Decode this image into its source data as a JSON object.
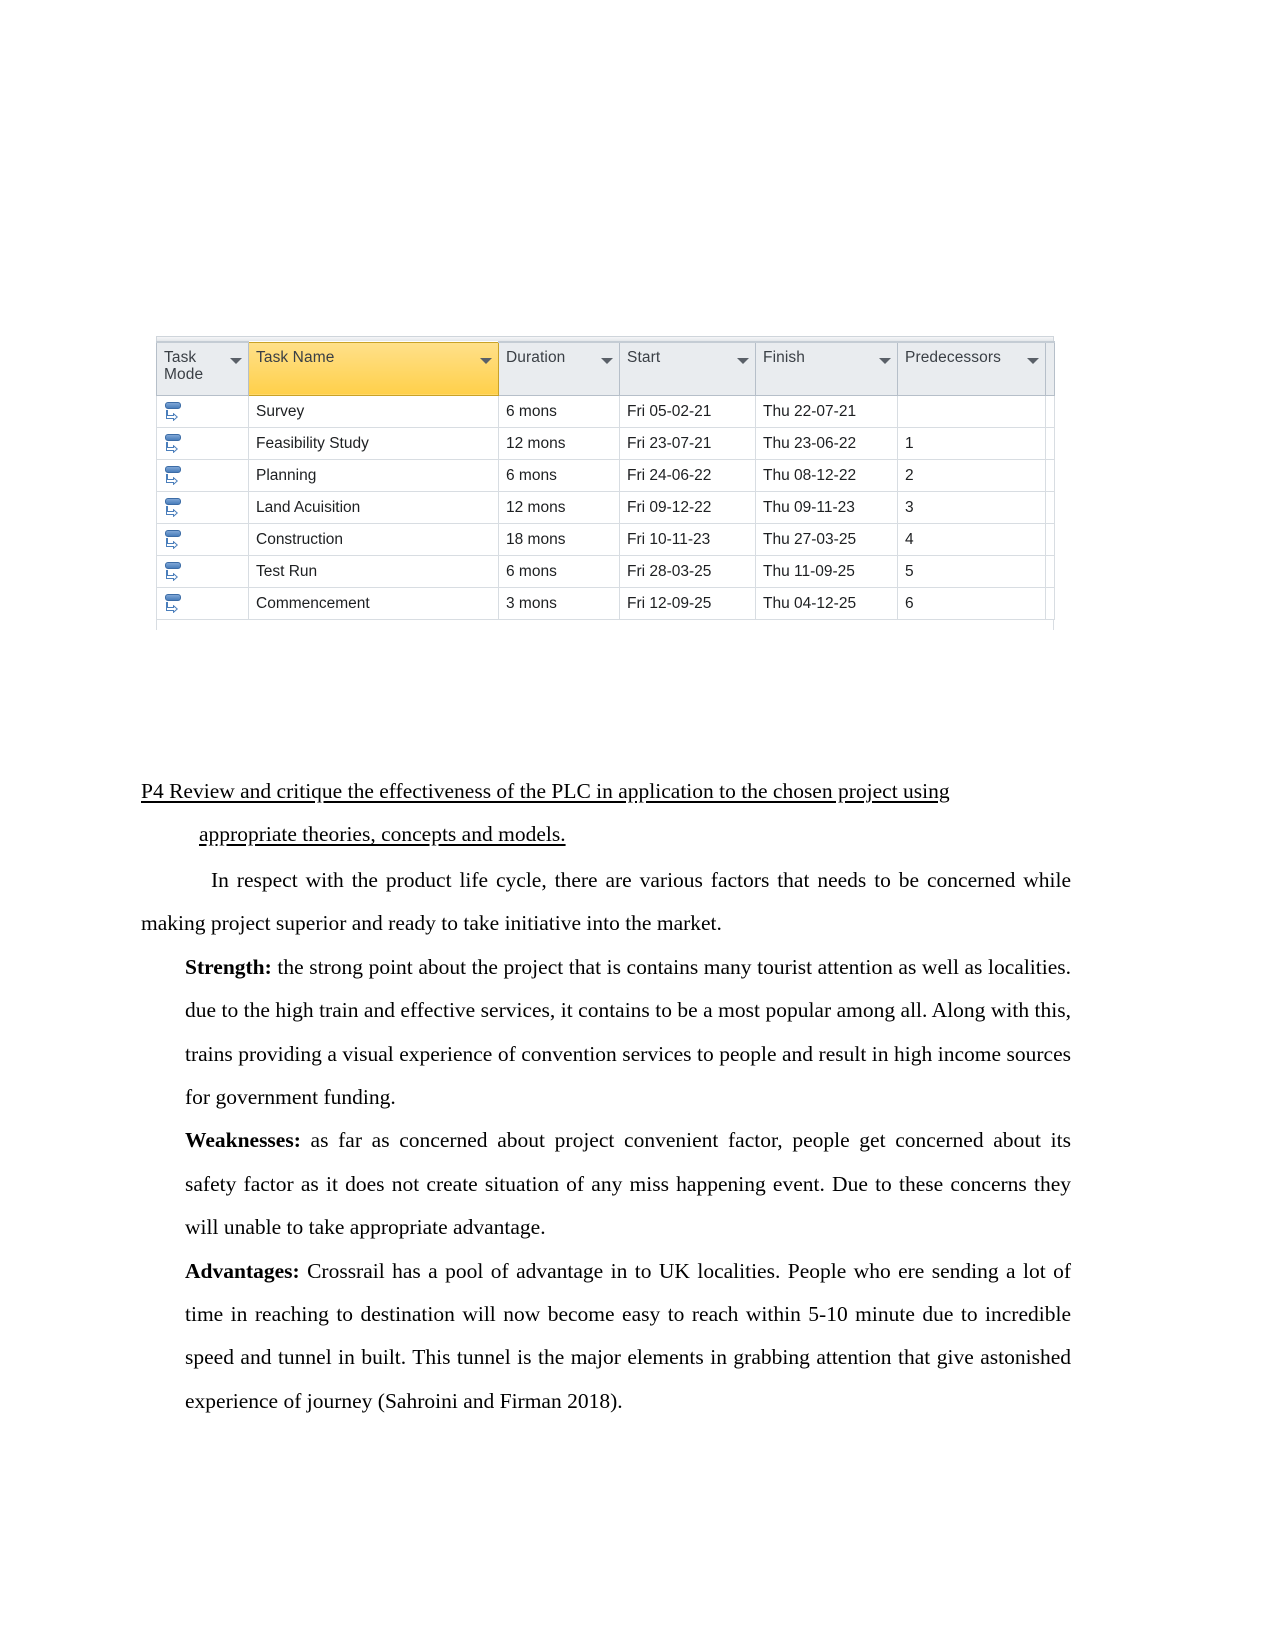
{
  "project_table": {
    "columns": [
      {
        "key": "task_mode",
        "label": "Task Mode",
        "highlighted": false,
        "has_filter": true
      },
      {
        "key": "task_name",
        "label": "Task Name",
        "highlighted": true,
        "has_filter": true
      },
      {
        "key": "duration",
        "label": "Duration",
        "highlighted": false,
        "has_filter": true
      },
      {
        "key": "start",
        "label": "Start",
        "highlighted": false,
        "has_filter": true
      },
      {
        "key": "finish",
        "label": "Finish",
        "highlighted": false,
        "has_filter": true
      },
      {
        "key": "predecessors",
        "label": "Predecessors",
        "highlighted": false,
        "has_filter": true
      }
    ],
    "mode_icon": "auto-scheduled-icon",
    "rows": [
      {
        "task_mode": "auto-scheduled",
        "task_name": "Survey",
        "duration": "6 mons",
        "start": "Fri 05-02-21",
        "finish": "Thu 22-07-21",
        "predecessors": ""
      },
      {
        "task_mode": "auto-scheduled",
        "task_name": "Feasibility Study",
        "duration": "12 mons",
        "start": "Fri 23-07-21",
        "finish": "Thu 23-06-22",
        "predecessors": "1"
      },
      {
        "task_mode": "auto-scheduled",
        "task_name": "Planning",
        "duration": "6 mons",
        "start": "Fri 24-06-22",
        "finish": "Thu 08-12-22",
        "predecessors": "2"
      },
      {
        "task_mode": "auto-scheduled",
        "task_name": "Land Acuisition",
        "duration": "12 mons",
        "start": "Fri 09-12-22",
        "finish": "Thu 09-11-23",
        "predecessors": "3"
      },
      {
        "task_mode": "auto-scheduled",
        "task_name": "Construction",
        "duration": "18 mons",
        "start": "Fri 10-11-23",
        "finish": "Thu 27-03-25",
        "predecessors": "4"
      },
      {
        "task_mode": "auto-scheduled",
        "task_name": "Test Run",
        "duration": "6 mons",
        "start": "Fri 28-03-25",
        "finish": "Thu 11-09-25",
        "predecessors": "5"
      },
      {
        "task_mode": "auto-scheduled",
        "task_name": "Commencement",
        "duration": "3 mons",
        "start": "Fri 12-09-25",
        "finish": "Thu 04-12-25",
        "predecessors": "6"
      }
    ],
    "colors": {
      "header_background": "#e9ecef",
      "header_highlight": "#ffd966",
      "grid_line": "#d8dde2",
      "mode_icon_blue": "#4a7ebb"
    }
  },
  "document": {
    "heading_line1": "P4 Review and critique the effectiveness of the PLC in application to the chosen project using",
    "heading_line2": "appropriate theories, concepts and models.",
    "intro_paragraph": "In respect with the product life cycle, there are various factors that needs to be concerned while making project superior and ready to take initiative into the market.",
    "points": [
      {
        "label": "Strength:",
        "text": " the strong point about the project that is contains many tourist attention as well as localities. due to the high train and effective services, it contains to be a most popular among all. Along with this, trains providing a visual experience of  convention services to people and result in high income sources for government funding."
      },
      {
        "label": "Weaknesses:",
        "text": " as far as concerned about project convenient factor, people get concerned about its safety factor as it does not create situation of any miss happening event. Due to these concerns they will unable to take appropriate  advantage."
      },
      {
        "label": "Advantages:",
        "text": " Crossrail has a pool of advantage in to UK localities. People who ere sending a lot of time in reaching to destination will now become easy to reach within 5-10 minute due to incredible speed and tunnel in built. This tunnel is the major elements in grabbing attention that give astonished experience of journey (Sahroini and Firman 2018)."
      }
    ]
  }
}
